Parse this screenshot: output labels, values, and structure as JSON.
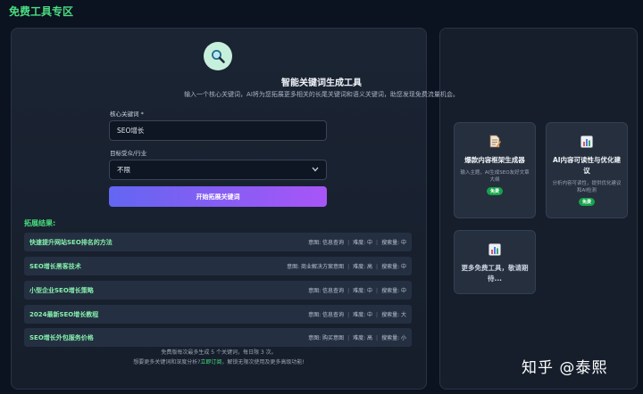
{
  "page_title": "免费工具专区",
  "tool": {
    "icon": "magnifier-icon",
    "title": "智能关键词生成工具",
    "description": "输入一个核心关键词，AI将为您拓展更多相关的长尾关键词和语义关键词，助您发现免费流量机会。"
  },
  "form": {
    "keyword_label": "核心关键词 *",
    "keyword_value": "SEO增长",
    "industry_label": "目标受众/行业",
    "industry_value": "不限",
    "submit_label": "开始拓展关键词"
  },
  "results": {
    "heading": "拓展结果:",
    "rows": [
      {
        "keyword": "快速提升网站SEO排名的方法",
        "intent_label": "意图: 信息查询",
        "difficulty_label": "难度: 中",
        "volume_label": "搜索量: 中"
      },
      {
        "keyword": "SEO增长黑客技术",
        "intent_label": "意图: 商业解决方案意图",
        "difficulty_label": "难度: 高",
        "volume_label": "搜索量: 中"
      },
      {
        "keyword": "小型企业SEO增长策略",
        "intent_label": "意图: 信息查询",
        "difficulty_label": "难度: 中",
        "volume_label": "搜索量: 中"
      },
      {
        "keyword": "2024最新SEO增长教程",
        "intent_label": "意图: 信息查询",
        "difficulty_label": "难度: 中",
        "volume_label": "搜索量: 大"
      },
      {
        "keyword": "SEO增长外包服务价格",
        "intent_label": "意图: 购买意图",
        "difficulty_label": "难度: 高",
        "volume_label": "搜索量: 小"
      }
    ]
  },
  "footnote": {
    "line1": "免费版每次最多生成 5 个关键词，每日限 3 次。",
    "line2_prefix": "想要更多关键词和深度分析?",
    "line2_link": "立即订阅",
    "line2_suffix": "，解锁无限次使用及更多高级功能!"
  },
  "cards": [
    {
      "icon": "document-icon",
      "title": "爆款内容框架生成器",
      "description": "输入主题，AI生成SEO友好文章大纲",
      "badge": "免费"
    },
    {
      "icon": "bar-chart-icon",
      "title": "AI内容可读性与优化建议",
      "description": "分析内容可读性，提供优化建议和AI检测",
      "badge": "免费"
    },
    {
      "icon": "bar-chart-icon",
      "title": "更多免费工具，敬请期待...",
      "description": "",
      "badge": ""
    }
  ],
  "watermark": "知乎 @泰熙"
}
